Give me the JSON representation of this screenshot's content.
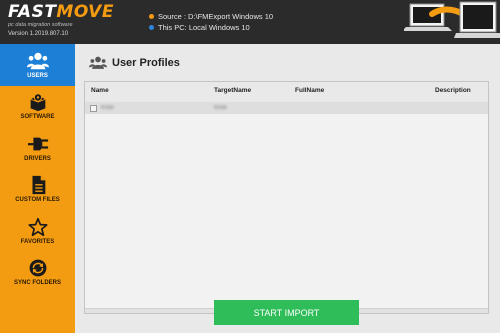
{
  "app": {
    "logo_fast": "FAST",
    "logo_move": "MOVE",
    "tagline": "pc data migration software",
    "version": "Version 1.2019.807.10",
    "brand_orange": "#f39c12",
    "brand_blue": "#1e7fd6"
  },
  "header": {
    "source_label": "Source : D:\\FMExport Windows 10",
    "target_label": "This PC: Local Windows 10",
    "source_dot_color": "#f39c12",
    "target_dot_color": "#2e86de"
  },
  "sidebar": {
    "items": [
      {
        "label": "USERS",
        "icon": "users-icon",
        "active": true
      },
      {
        "label": "SOFTWARE",
        "icon": "software-box-icon",
        "active": false
      },
      {
        "label": "DRIVERS",
        "icon": "plug-icon",
        "active": false
      },
      {
        "label": "CUSTOM FILES",
        "icon": "file-icon",
        "active": false
      },
      {
        "label": "FAVORITES",
        "icon": "star-icon",
        "active": false
      },
      {
        "label": "SYNC FOLDERS",
        "icon": "sync-icon",
        "active": false
      }
    ]
  },
  "main": {
    "title": "User Profiles",
    "title_icon": "users-icon",
    "columns": [
      "Name",
      "TargetName",
      "FullName",
      "Description"
    ],
    "rows": [
      {
        "name": "Kree",
        "target_name": "Kree",
        "full_name": "",
        "description": "",
        "checked": false
      }
    ],
    "start_button": "START IMPORT"
  }
}
